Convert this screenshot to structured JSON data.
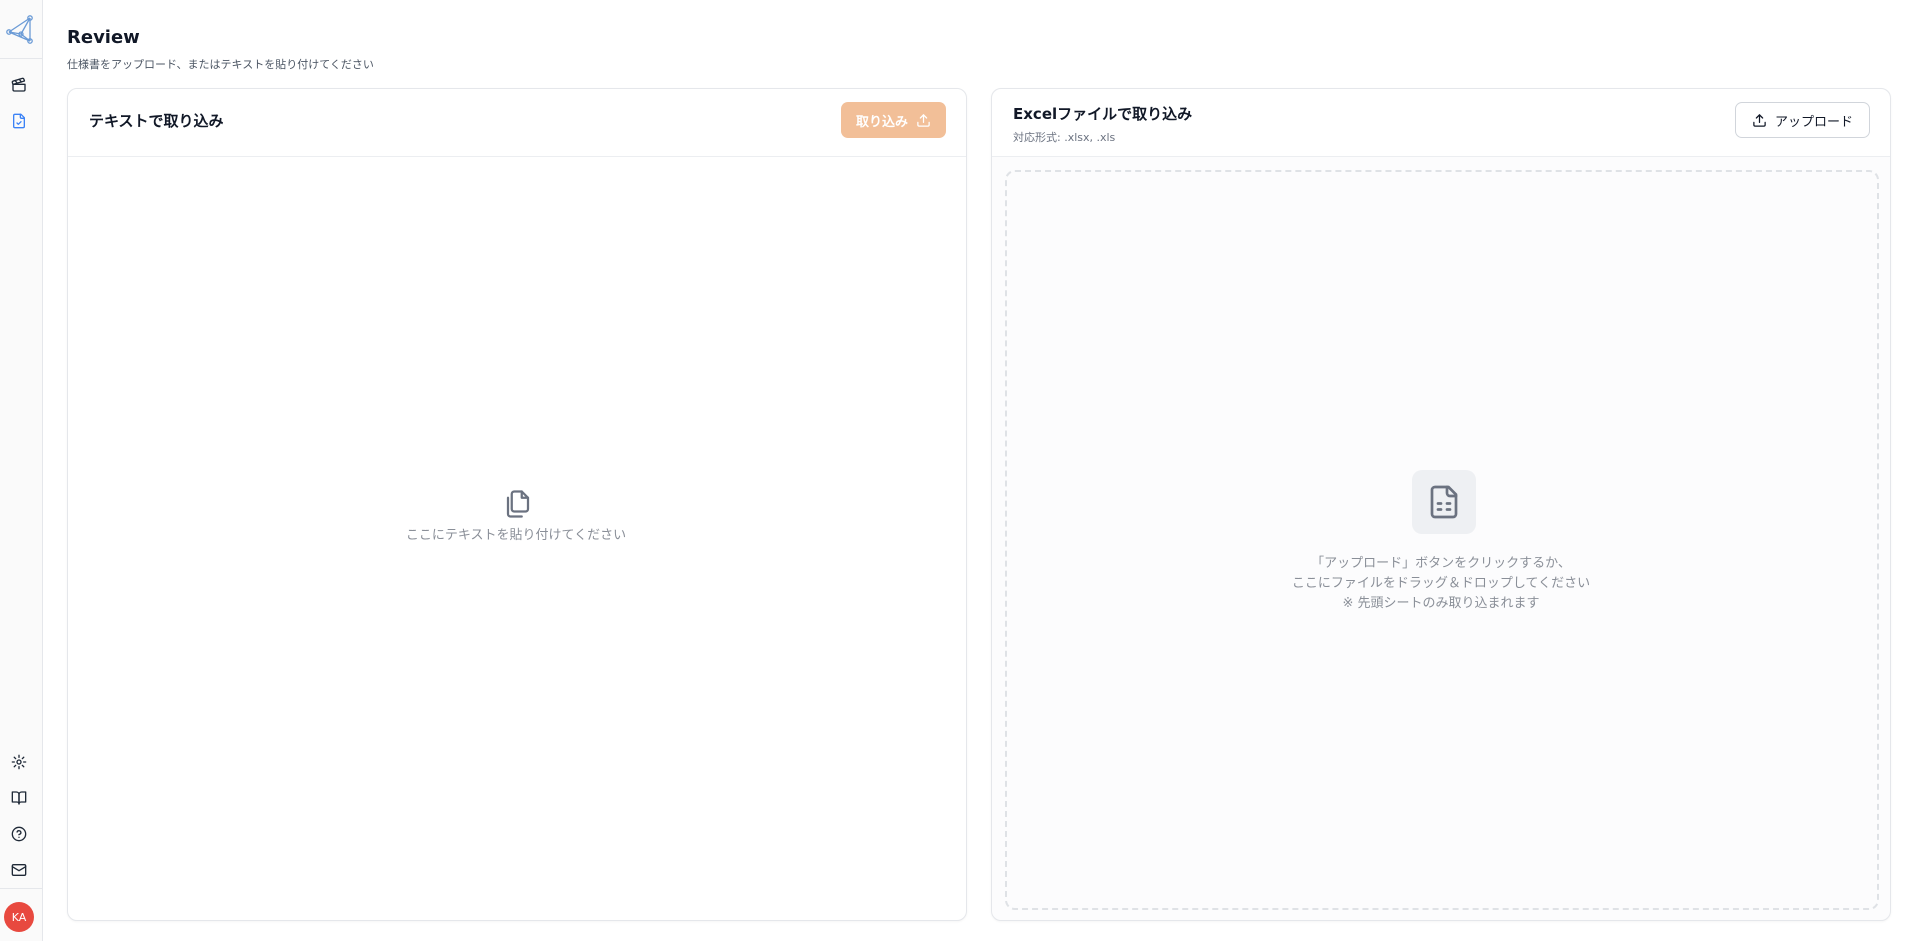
{
  "header": {
    "title": "Review",
    "subtitle": "仕様書をアップロード、またはテキストを貼り付けてください"
  },
  "sidebar": {
    "top_items": [
      {
        "icon": "clapperboard-icon"
      },
      {
        "icon": "file-check-icon",
        "active": true
      }
    ],
    "bottom_items": [
      {
        "icon": "gear-icon"
      },
      {
        "icon": "book-open-icon"
      },
      {
        "icon": "help-circle-icon"
      },
      {
        "icon": "mail-icon"
      }
    ],
    "avatar_initials": "KA"
  },
  "text_import": {
    "title": "テキストで取り込み",
    "button_label": "取り込み",
    "placeholder": "ここにテキストを貼り付けてください"
  },
  "excel_import": {
    "title": "Excelファイルで取り込み",
    "formats": "対応形式: .xlsx, .xls",
    "upload_label": "アップロード",
    "drop_line1": "「アップロード」ボタンをクリックするか、",
    "drop_line2": "ここにファイルをドラッグ＆ドロップしてください",
    "drop_line3": "※ 先頭シートのみ取り込まれます"
  },
  "colors": {
    "accent": "#f2bf98",
    "avatar": "#e8493f",
    "active_icon": "#3b82f6"
  }
}
